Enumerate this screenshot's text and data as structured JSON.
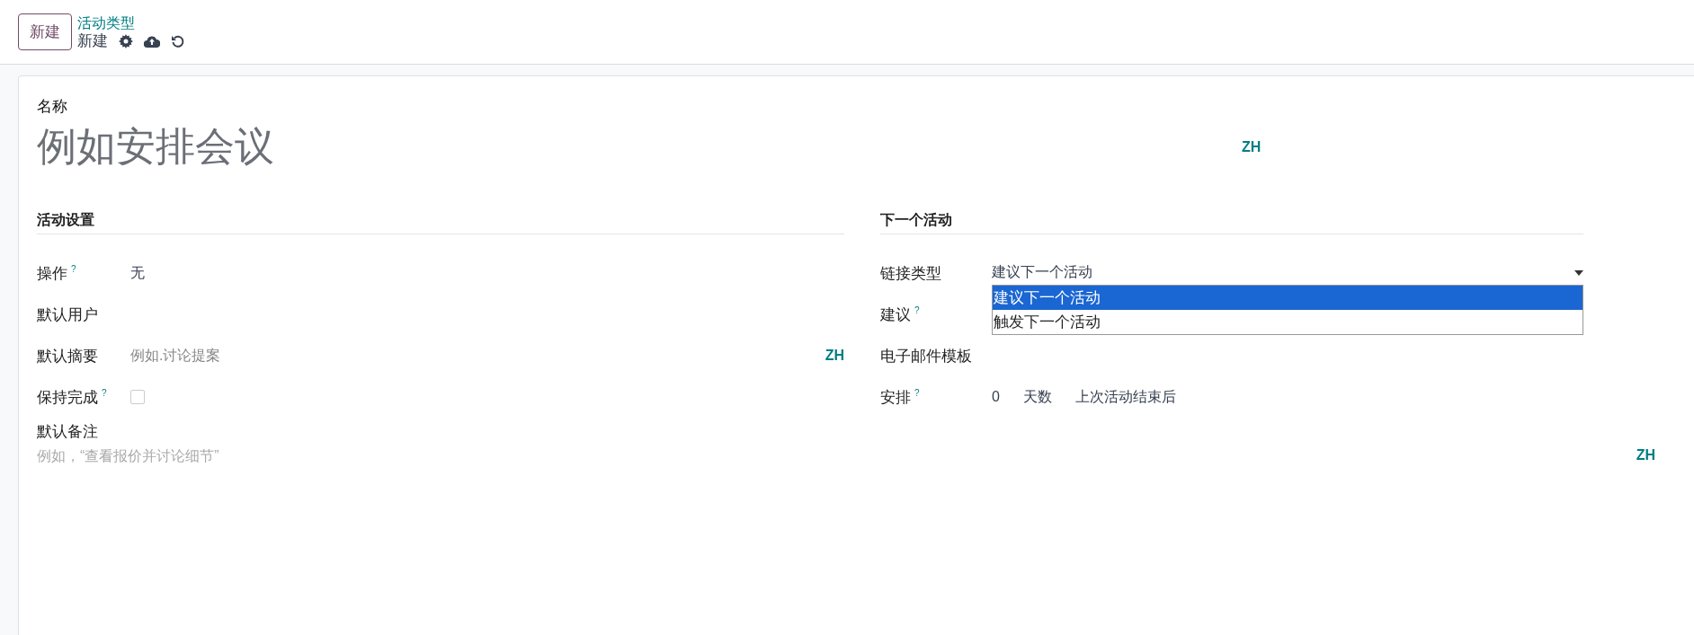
{
  "header": {
    "new_button": "新建",
    "breadcrumb": "活动类型",
    "record_name": "新建"
  },
  "form": {
    "name_label": "名称",
    "name_placeholder": "例如安排会议",
    "name_lang": "ZH",
    "left": {
      "title": "活动设置",
      "fields": [
        {
          "kind": "value",
          "label": "操作",
          "help": "?",
          "value": "无"
        },
        {
          "kind": "empty",
          "label": "默认用户"
        },
        {
          "kind": "placeholder",
          "label": "默认摘要",
          "placeholder": "例如.讨论提案",
          "lang": "ZH"
        },
        {
          "kind": "checkbox",
          "label": "保持完成",
          "help": "?",
          "checked": false
        }
      ]
    },
    "note": {
      "label": "默认备注",
      "placeholder": "例如，“查看报价并讨论细节”",
      "lang": "ZH"
    },
    "right": {
      "title": "下一个活动",
      "fields": [
        {
          "kind": "select",
          "label": "链接类型",
          "value": "建议下一个活动",
          "options": [
            {
              "label": "建议下一个活动",
              "selected": true
            },
            {
              "label": "触发下一个活动",
              "selected": false
            }
          ]
        },
        {
          "kind": "empty",
          "label": "建议",
          "help": "?"
        },
        {
          "kind": "empty",
          "label": "电子邮件模板"
        },
        {
          "kind": "schedule",
          "label": "安排",
          "help": "?",
          "amount": "0",
          "unit": "天数",
          "trigger": "上次活动结束后"
        }
      ]
    }
  }
}
